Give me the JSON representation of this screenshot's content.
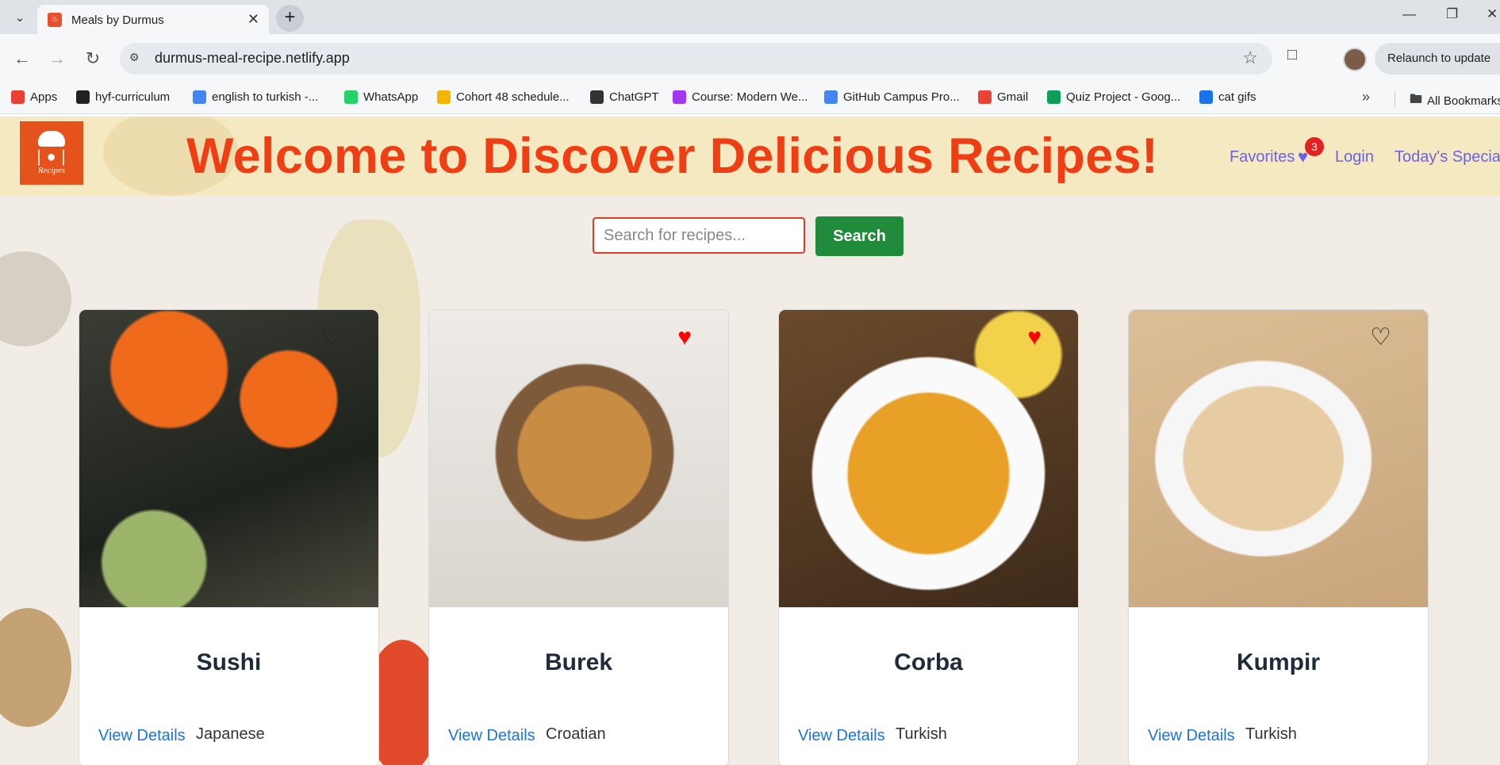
{
  "browser": {
    "tab_title": "Meals by Durmus",
    "url": "durmus-meal-recipe.netlify.app",
    "relaunch_label": "Relaunch to update",
    "bookmarks": [
      {
        "label": "Apps",
        "icon": "apps-grid-icon",
        "color": "#e94235"
      },
      {
        "label": "hyf-curriculum",
        "icon": "github-icon",
        "color": "#222222"
      },
      {
        "label": "english to turkish -...",
        "icon": "google-icon",
        "color": "#4285f4"
      },
      {
        "label": "WhatsApp",
        "icon": "whatsapp-icon",
        "color": "#25d366"
      },
      {
        "label": "Cohort 48 schedule...",
        "icon": "google-drive-icon",
        "color": "#f4b400"
      },
      {
        "label": "ChatGPT",
        "icon": "chatgpt-icon",
        "color": "#333333"
      },
      {
        "label": "Course: Modern We...",
        "icon": "udemy-icon",
        "color": "#a435f0"
      },
      {
        "label": "GitHub Campus Pro...",
        "icon": "docs-icon",
        "color": "#4285f4"
      },
      {
        "label": "Gmail",
        "icon": "gmail-icon",
        "color": "#ea4335"
      },
      {
        "label": "Quiz Project - Goog...",
        "icon": "sheets-icon",
        "color": "#0f9d58"
      },
      {
        "label": "cat gifs",
        "icon": "gif-icon",
        "color": "#1a73e8"
      }
    ],
    "all_bookmarks_label": "All Bookmarks"
  },
  "header": {
    "logo_text": "Recipes",
    "headline": "Welcome to Discover Delicious Recipes!",
    "nav": {
      "favorites": "Favorites",
      "favorites_count": "3",
      "login": "Login",
      "todays_special": "Today's Special"
    }
  },
  "search": {
    "placeholder": "Search for recipes...",
    "value": "",
    "button_label": "Search"
  },
  "colors": {
    "headline": "#ef3e14",
    "nav_link": "#6b61ea",
    "search_button": "#1f8b3b",
    "search_border": "#e03b25",
    "link_blue": "#1a73e8",
    "favorite_red": "#ff0000"
  },
  "recipes": [
    {
      "name": "Sushi",
      "cuisine": "Japanese",
      "favorited": false,
      "link_label": "View Details"
    },
    {
      "name": "Burek",
      "cuisine": "Croatian",
      "favorited": true,
      "link_label": "View Details"
    },
    {
      "name": "Corba",
      "cuisine": "Turkish",
      "favorited": true,
      "link_label": "View Details"
    },
    {
      "name": "Kumpir",
      "cuisine": "Turkish",
      "favorited": false,
      "link_label": "View Details"
    }
  ]
}
